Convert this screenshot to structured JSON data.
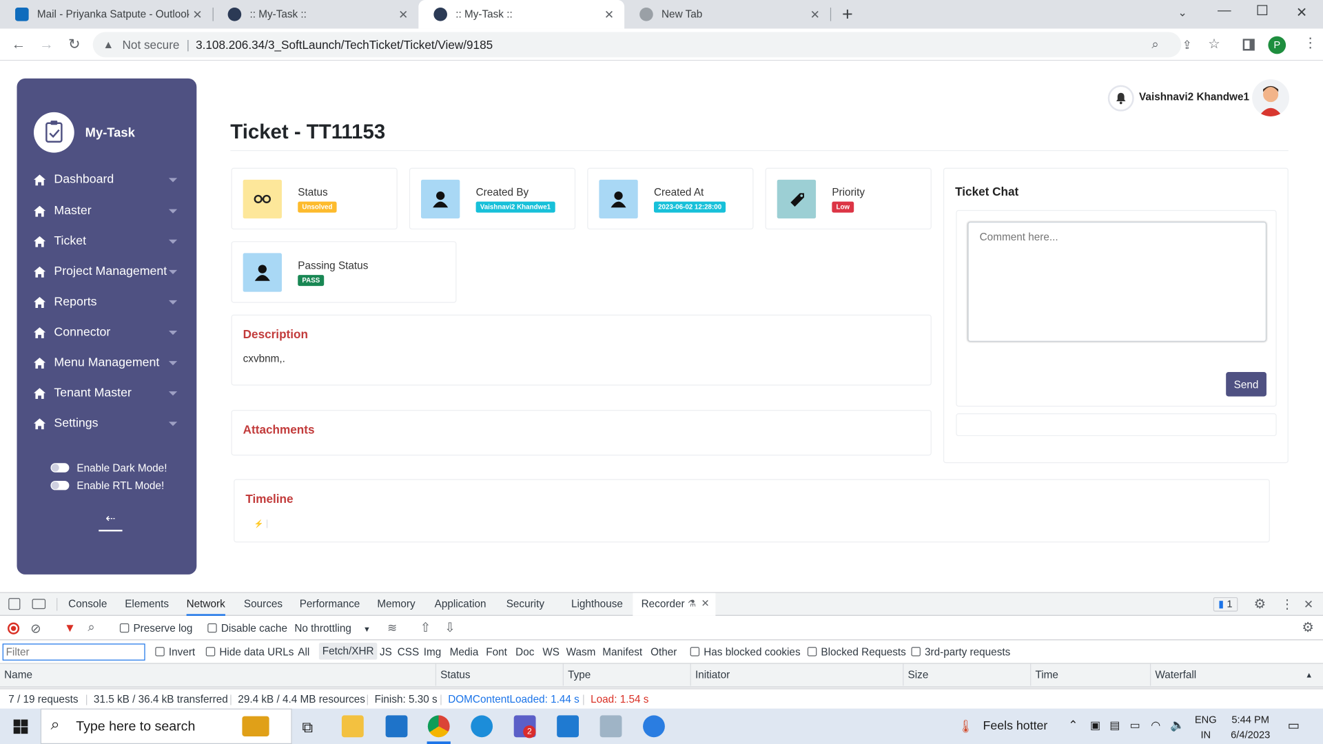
{
  "browser": {
    "tabs": [
      {
        "title": "Mail - Priyanka Satpute - Outlook"
      },
      {
        "title": ":: My-Task ::"
      },
      {
        "title": ":: My-Task ::"
      },
      {
        "title": "New Tab"
      }
    ],
    "security_label": "Not secure",
    "url": "3.108.206.34/3_SoftLaunch/TechTicket/Ticket/View/9185",
    "profile_initial": "P"
  },
  "app": {
    "logo_text": "My-Task",
    "nav": [
      {
        "label": "Dashboard"
      },
      {
        "label": "Master"
      },
      {
        "label": "Ticket"
      },
      {
        "label": "Project Management"
      },
      {
        "label": "Reports"
      },
      {
        "label": "Connector"
      },
      {
        "label": "Menu Management"
      },
      {
        "label": "Tenant Master"
      },
      {
        "label": "Settings"
      }
    ],
    "dark_mode_label": "Enable Dark Mode!",
    "rtl_mode_label": "Enable RTL Mode!"
  },
  "header": {
    "user_name": "Vaishnavi2 Khandwe1"
  },
  "page": {
    "title": "Ticket - TT11153",
    "status": {
      "title": "Status",
      "value": "Unsolved"
    },
    "created_by": {
      "title": "Created By",
      "value": "Vaishnavi2 Khandwe1"
    },
    "created_at": {
      "title": "Created At",
      "value": "2023-06-02 12:28:00"
    },
    "priority": {
      "title": "Priority",
      "value": "Low"
    },
    "passing_status": {
      "title": "Passing Status",
      "value": "PASS"
    },
    "description": {
      "title": "Description",
      "text": "cxvbnm,."
    },
    "attachments": {
      "title": "Attachments"
    },
    "timeline": {
      "title": "Timeline"
    }
  },
  "chat": {
    "title": "Ticket Chat",
    "placeholder": "Comment here...",
    "send_label": "Send"
  },
  "colors": {
    "sidebar": "#4f5182",
    "status_badge": "#fdbb2d",
    "created_by_badge": "#17c0d9",
    "priority_badge": "#dc3545",
    "pass_badge": "#198754",
    "send_button": "#4f5182",
    "section_title": "#c23b3b"
  },
  "devtools": {
    "tabs": [
      "Console",
      "Elements",
      "Network",
      "Sources",
      "Performance",
      "Memory",
      "Application",
      "Security",
      "Lighthouse",
      "Recorder"
    ],
    "issues_count": "1",
    "preserve_log": "Preserve log",
    "disable_cache": "Disable cache",
    "throttling": "No throttling",
    "filter_placeholder": "Filter",
    "invert": "Invert",
    "hide_data_urls": "Hide data URLs",
    "filter_types": [
      "All",
      "Fetch/XHR",
      "JS",
      "CSS",
      "Img",
      "Media",
      "Font",
      "Doc",
      "WS",
      "Wasm",
      "Manifest",
      "Other"
    ],
    "has_blocked_cookies": "Has blocked cookies",
    "blocked_requests": "Blocked Requests",
    "third_party": "3rd-party requests",
    "columns": [
      "Name",
      "Status",
      "Type",
      "Initiator",
      "Size",
      "Time",
      "Waterfall"
    ],
    "summary": {
      "requests": "7 / 19 requests",
      "transferred": "31.5 kB / 36.4 kB transferred",
      "resources": "29.4 kB / 4.4 MB resources",
      "finish": "Finish: 5.30 s",
      "dom_loaded": "DOMContentLoaded: 1.44 s",
      "load": "Load: 1.54 s"
    }
  },
  "taskbar": {
    "search_placeholder": "Type here to search",
    "teams_badge": "2",
    "weather": "Feels hotter",
    "lang_top": "ENG",
    "lang_bottom": "IN",
    "time": "5:44 PM",
    "date": "6/4/2023"
  }
}
